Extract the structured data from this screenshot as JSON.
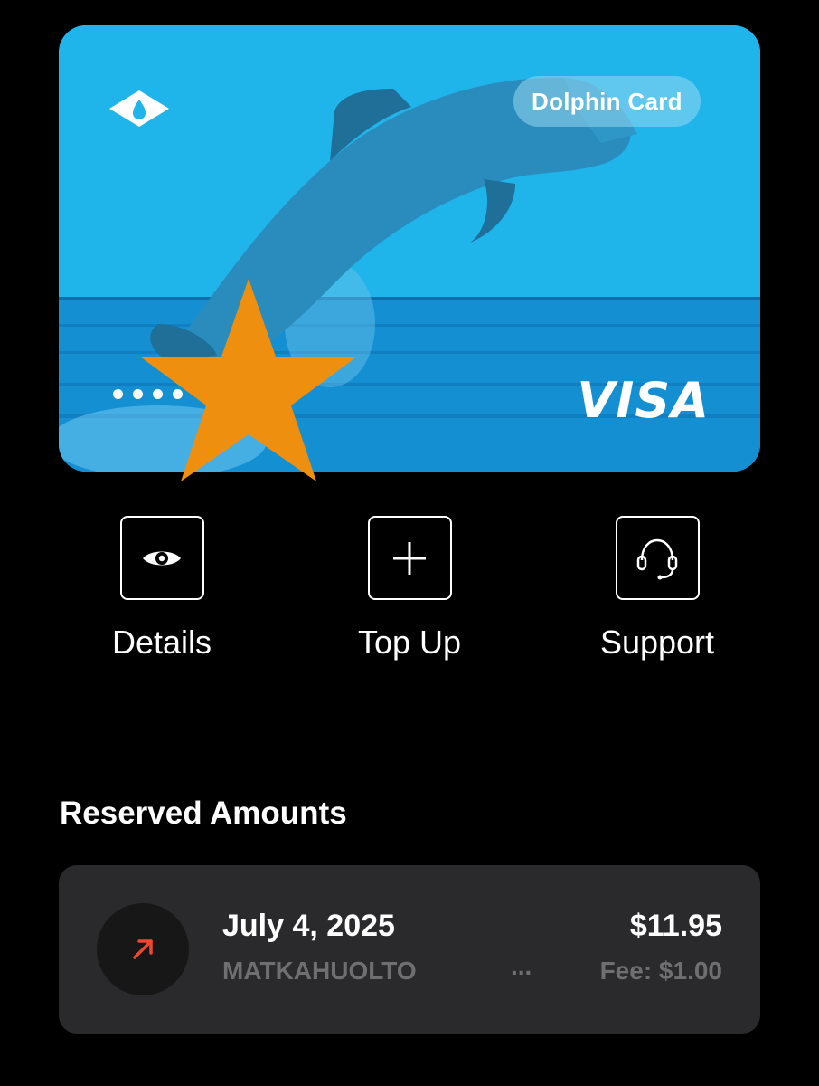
{
  "card": {
    "name": "Dolphin Card",
    "network": "VISA",
    "masked_number": "••••"
  },
  "actions": [
    {
      "label": "Details",
      "icon": "eye-icon"
    },
    {
      "label": "Top Up",
      "icon": "plus-icon"
    },
    {
      "label": "Support",
      "icon": "headset-icon"
    }
  ],
  "reserved": {
    "title": "Reserved Amounts",
    "items": [
      {
        "date": "July 4, 2025",
        "merchant": "MATKAHUOLTO",
        "more": "...",
        "amount": "$11.95",
        "fee": "Fee: $1.00",
        "icon": "arrow-up-right-icon"
      }
    ]
  },
  "colors": {
    "background": "#000000",
    "card_blue": "#1ab6ea",
    "star": "#ef8f0f",
    "tile": "#2a2a2c",
    "accent_arrow": "#e8492f"
  }
}
